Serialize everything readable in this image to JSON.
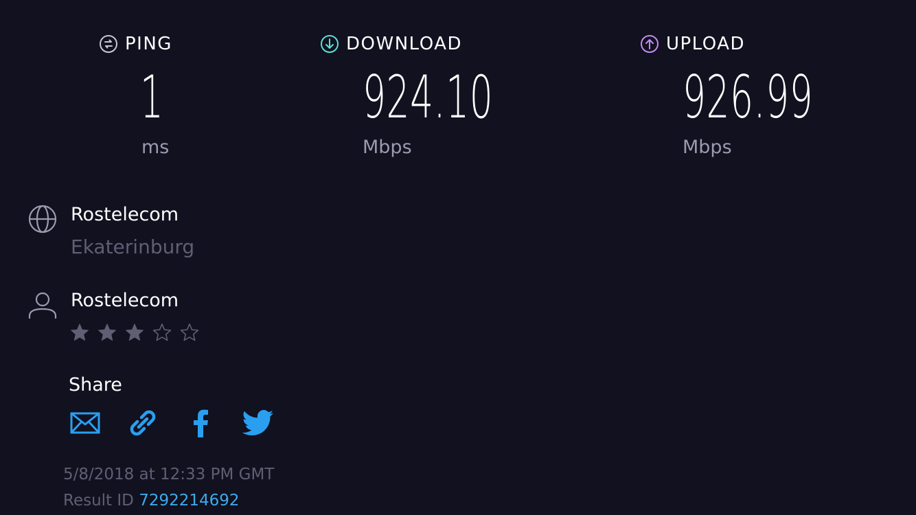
{
  "metrics": {
    "ping": {
      "label": "PING",
      "value": "1",
      "unit": "ms",
      "icon": "ping-icon",
      "color": "#c8c8d2"
    },
    "download": {
      "label": "DOWNLOAD",
      "value": "924.10",
      "unit": "Mbps",
      "icon": "download-arrow-icon",
      "color": "#5ee0d6"
    },
    "upload": {
      "label": "UPLOAD",
      "value": "926.99",
      "unit": "Mbps",
      "icon": "upload-arrow-icon",
      "color": "#c58cf2"
    }
  },
  "isp": {
    "name": "Rostelecom",
    "location": "Ekaterinburg",
    "icon": "globe-icon"
  },
  "provider": {
    "name": "Rostelecom",
    "icon": "user-icon",
    "rating": 3,
    "rating_max": 5
  },
  "share": {
    "label": "Share",
    "buttons": [
      {
        "name": "email",
        "icon": "email-icon"
      },
      {
        "name": "link",
        "icon": "link-icon"
      },
      {
        "name": "facebook",
        "icon": "facebook-icon"
      },
      {
        "name": "twitter",
        "icon": "twitter-icon"
      }
    ],
    "accent": "#2a9ff0"
  },
  "result": {
    "timestamp": "5/8/2018 at 12:33 PM GMT",
    "id_label": "Result ID",
    "id": "7292214692"
  },
  "colors": {
    "background": "#111120",
    "muted": "#5f5f74",
    "link": "#3fa9e8"
  }
}
